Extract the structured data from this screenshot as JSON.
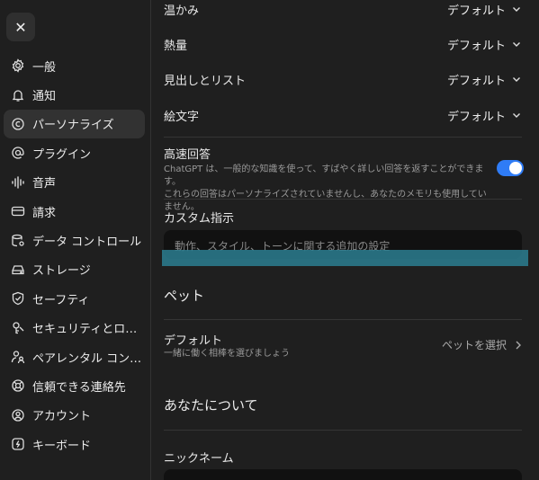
{
  "sidebar": {
    "items": [
      {
        "label": "一般",
        "icon": "gear-icon"
      },
      {
        "label": "通知",
        "icon": "bell-icon"
      },
      {
        "label": "パーソナライズ",
        "icon": "personalize-icon",
        "active": true
      },
      {
        "label": "プラグイン",
        "icon": "at-icon"
      },
      {
        "label": "音声",
        "icon": "waveform-icon"
      },
      {
        "label": "請求",
        "icon": "card-icon"
      },
      {
        "label": "データ コントロール",
        "icon": "database-icon"
      },
      {
        "label": "ストレージ",
        "icon": "storage-icon"
      },
      {
        "label": "セーフティ",
        "icon": "shield-icon"
      },
      {
        "label": "セキュリティとログイン",
        "icon": "lock-icon"
      },
      {
        "label": "ペアレンタル コントロー...",
        "icon": "parental-icon"
      },
      {
        "label": "信頼できる連絡先",
        "icon": "lifebuoy-icon"
      },
      {
        "label": "アカウント",
        "icon": "user-icon"
      },
      {
        "label": "キーボード",
        "icon": "keyboard-icon"
      }
    ]
  },
  "main": {
    "rows": [
      {
        "label": "温かみ",
        "value": "デフォルト"
      },
      {
        "label": "熱量",
        "value": "デフォルト"
      },
      {
        "label": "見出しとリスト",
        "value": "デフォルト"
      },
      {
        "label": "絵文字",
        "value": "デフォルト"
      }
    ],
    "fast_answer": {
      "label": "高速回答",
      "desc1": "ChatGPT は、一般的な知識を使って、すばやく詳しい回答を返すことができます。",
      "desc2": "これらの回答はパーソナライズされていませんし、あなたのメモリも使用していません。",
      "enabled": true
    },
    "custom": {
      "title": "カスタム指示",
      "placeholder": "動作、スタイル、トーンに関する追加の設定"
    },
    "pet": {
      "title": "ペット",
      "default_label": "デフォルト",
      "default_desc": "一緒に働く相棒を選びましょう",
      "select_label": "ペットを選択"
    },
    "about": {
      "title": "あなたについて",
      "nickname_label": "ニックネーム"
    }
  },
  "colors": {
    "accent": "#2f7cf6",
    "highlight": "#2c7e91"
  }
}
